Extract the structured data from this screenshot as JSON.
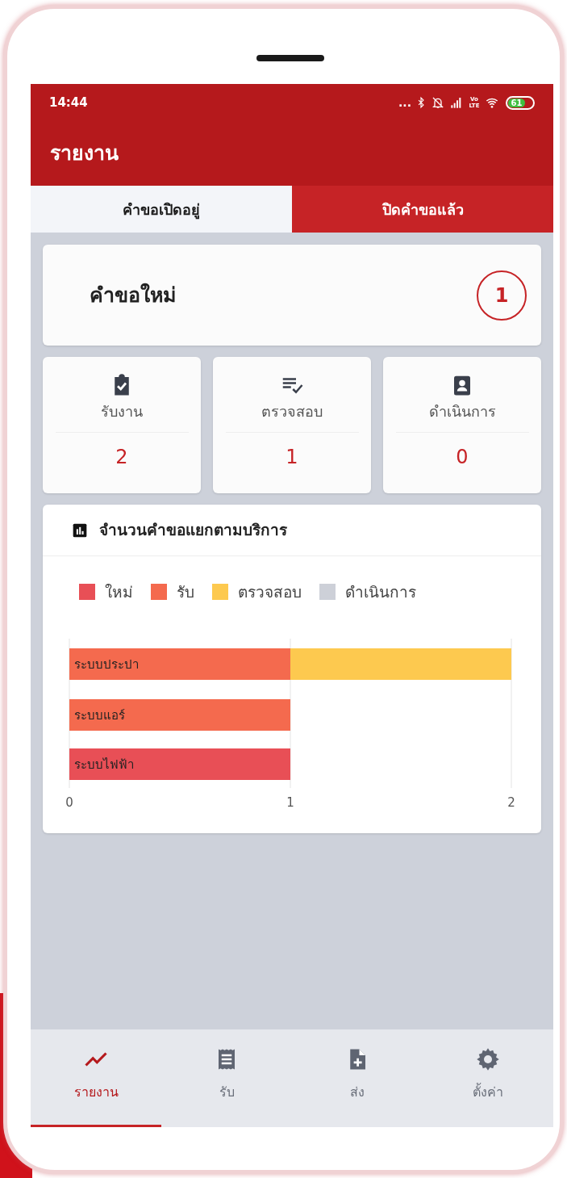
{
  "status_bar": {
    "time": "14:44",
    "more": "...",
    "network_label": "Vo LTE",
    "battery": "61"
  },
  "header": {
    "title": "รายงาน"
  },
  "tabs": [
    {
      "label": "คำขอเปิดอยู่",
      "selected": true
    },
    {
      "label": "ปิดคำขอแล้ว",
      "selected": false
    }
  ],
  "new_requests": {
    "label": "คำขอใหม่",
    "count": "1"
  },
  "stats": [
    {
      "kind": "clipboard",
      "label": "รับงาน",
      "value": "2"
    },
    {
      "kind": "checklist",
      "label": "ตรวจสอบ",
      "value": "1"
    },
    {
      "kind": "badge",
      "label": "ดำเนินการ",
      "value": "0"
    }
  ],
  "chart_card": {
    "title": "จำนวนคำขอแยกตามบริการ",
    "chart_data": {
      "type": "bar",
      "orientation": "horizontal",
      "stacked": true,
      "categories": [
        "ระบบประปา",
        "ระบบแอร์",
        "ระบบไฟฟ้า"
      ],
      "series": [
        {
          "name": "ใหม่",
          "color": "#e84f56",
          "values": [
            0,
            0,
            1
          ]
        },
        {
          "name": "รับ",
          "color": "#f46a4e",
          "values": [
            1,
            1,
            0
          ]
        },
        {
          "name": "ตรวจสอบ",
          "color": "#fdc94f",
          "values": [
            1,
            0,
            0
          ]
        },
        {
          "name": "ดำเนินการ",
          "color": "#cdd0d8",
          "values": [
            0,
            0,
            0
          ]
        }
      ],
      "xlim": [
        0,
        2
      ],
      "xticks": [
        0,
        1,
        2
      ]
    }
  },
  "bottom_nav": [
    {
      "kind": "report",
      "label": "รายงาน",
      "selected": true
    },
    {
      "kind": "receipt",
      "label": "รับ",
      "selected": false
    },
    {
      "kind": "file",
      "label": "ส่ง",
      "selected": false
    },
    {
      "kind": "settings",
      "label": "ตั้งค่า",
      "selected": false
    }
  ]
}
